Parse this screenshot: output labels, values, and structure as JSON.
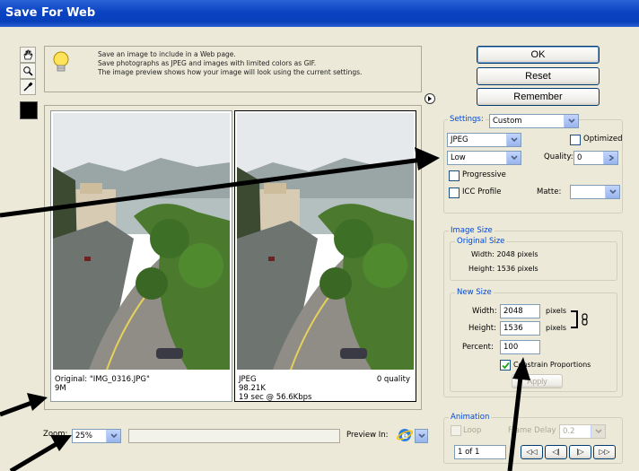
{
  "window": {
    "title": "Save For Web"
  },
  "tip": {
    "line1": "Save an image to include in a Web page.",
    "line2": "Save photographs as JPEG and images with limited colors as GIF.",
    "line3": "The image preview shows how your image will look using the current settings."
  },
  "buttons": {
    "ok": "OK",
    "reset": "Reset",
    "remember": "Remember",
    "apply": "Apply"
  },
  "settings": {
    "label": "Settings:",
    "preset": "Custom",
    "format": "JPEG",
    "optimized_label": "Optimized",
    "quality_preset": "Low",
    "quality_label": "Quality:",
    "quality_value": "0",
    "progressive_label": "Progressive",
    "icc_label": "ICC Profile",
    "matte_label": "Matte:"
  },
  "image_size": {
    "legend": "Image Size",
    "original_legend": "Original Size",
    "orig_width": "Width: 2048 pixels",
    "orig_height": "Height: 1536 pixels",
    "new_legend": "New Size",
    "width_label": "Width:",
    "width_value": "2048",
    "height_label": "Height:",
    "height_value": "1536",
    "unit": "pixels",
    "percent_label": "Percent:",
    "percent_value": "100",
    "constrain_label": "Constrain Proportions"
  },
  "animation": {
    "legend": "Animation",
    "loop_label": "Loop",
    "frame_delay_label": "Frame Delay",
    "frame_delay_value": "0.2",
    "frame_counter": "1 of 1",
    "first_frame": "◁◁",
    "prev_frame": "◁|",
    "next_frame": "|▷",
    "last_frame": "▷▷"
  },
  "preview_left": {
    "caption1": "Original: \"IMG_0316.JPG\"",
    "caption2": "9M"
  },
  "preview_right": {
    "format": "JPEG",
    "quality": "0 quality",
    "size": "98.21K",
    "download": "19 sec @ 56.6Kbps"
  },
  "bottom": {
    "zoom_label": "Zoom:",
    "zoom_value": "25%",
    "preview_in_label": "Preview In:"
  },
  "colors": {
    "title_blue": "#0a43c2",
    "legend_blue": "#0046d5",
    "dialog_bg": "#ece9d8"
  }
}
